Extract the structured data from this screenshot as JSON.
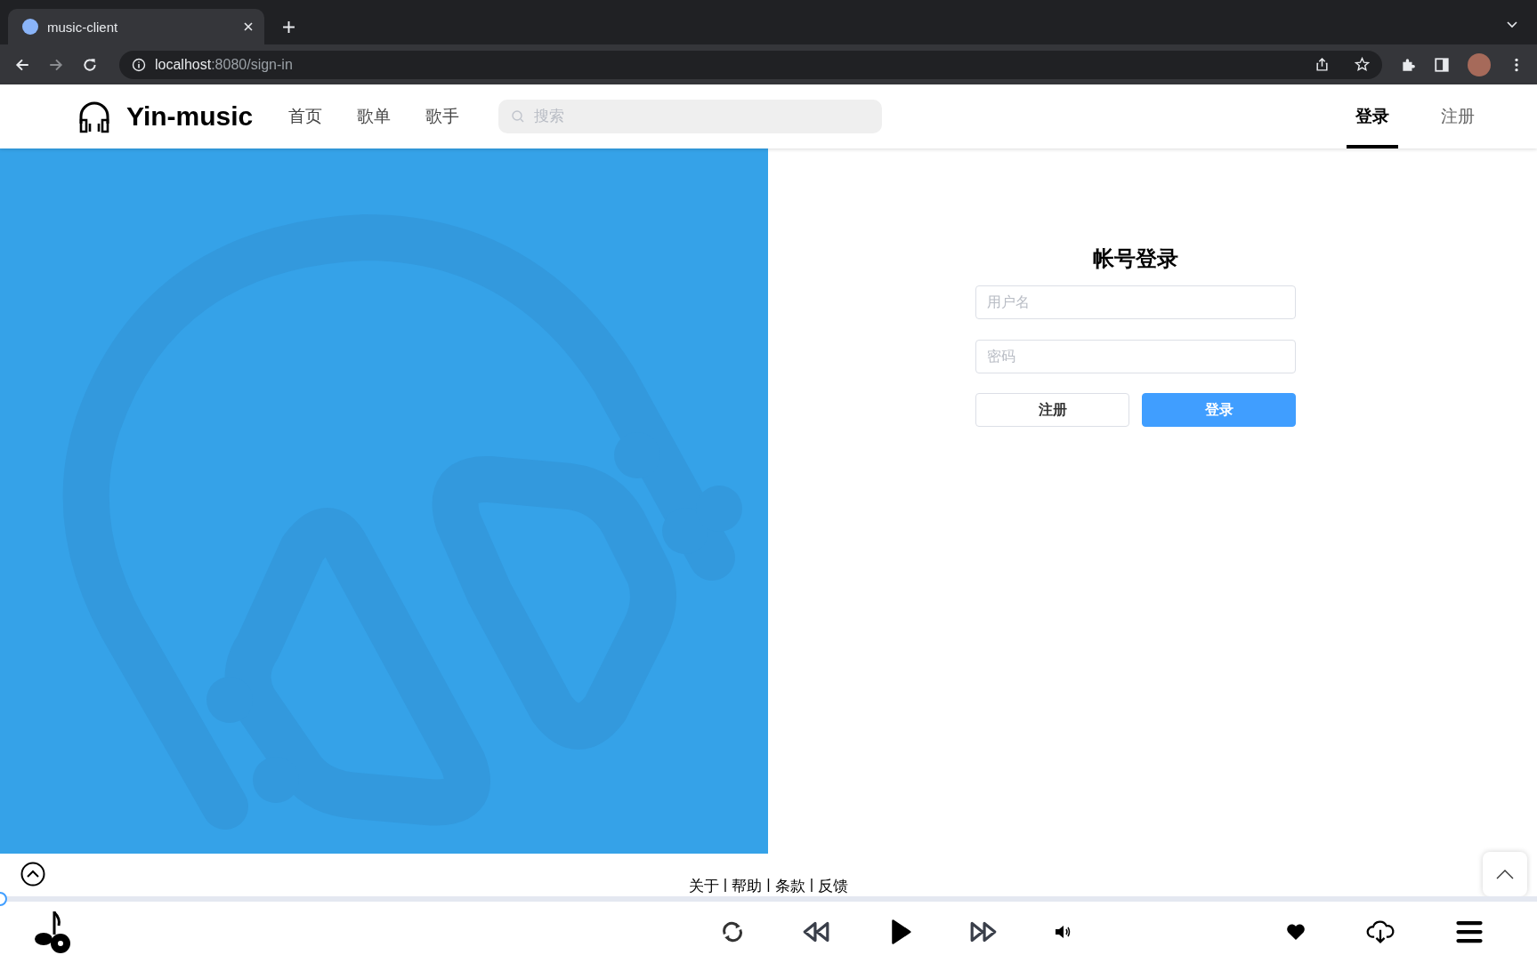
{
  "browser": {
    "tab": {
      "title": "music-client"
    },
    "url": {
      "host": "localhost",
      "path": ":8080/sign-in"
    }
  },
  "header": {
    "brand": "Yin-music",
    "nav": [
      {
        "label": "首页"
      },
      {
        "label": "歌单"
      },
      {
        "label": "歌手"
      }
    ],
    "search": {
      "placeholder": "搜索"
    },
    "auth_tabs": [
      {
        "label": "登录",
        "selected": true
      },
      {
        "label": "注册",
        "selected": false
      }
    ]
  },
  "login": {
    "title": "帐号登录",
    "fields": [
      {
        "placeholder": "用户名"
      },
      {
        "placeholder": "密码"
      }
    ],
    "buttons": [
      {
        "label": "注册",
        "kind": "secondary"
      },
      {
        "label": "登录",
        "kind": "primary"
      }
    ]
  },
  "footer": {
    "links": [
      "关于",
      "帮助",
      "条款",
      "反馈"
    ],
    "separator": "|"
  },
  "player": {
    "progress": {
      "level": 0
    }
  }
}
